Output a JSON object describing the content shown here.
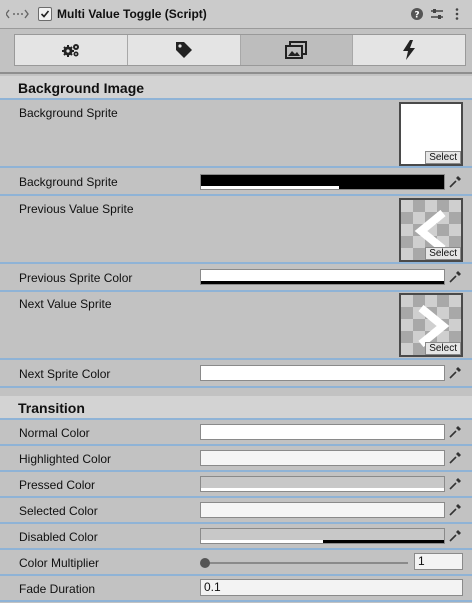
{
  "header": {
    "title": "Multi Value Toggle (Script)",
    "enabled": true
  },
  "tabs": [
    {
      "name": "settings",
      "icon": "gears-icon",
      "active": false
    },
    {
      "name": "labels",
      "icon": "tag-icon",
      "active": false
    },
    {
      "name": "images",
      "icon": "images-icon",
      "active": true
    },
    {
      "name": "events",
      "icon": "lightning-icon",
      "active": false
    }
  ],
  "background_image": {
    "section_label": "Background Image",
    "sprite_label": "Background Sprite",
    "color_label": "Background Sprite",
    "color": "#000000",
    "select_label": "Select"
  },
  "previous": {
    "sprite_label": "Previous Value Sprite",
    "color_label": "Previous Sprite Color",
    "color": "#ffffff",
    "select_label": "Select"
  },
  "next": {
    "sprite_label": "Next Value Sprite",
    "color_label": "Next Sprite Color",
    "color": "#ffffff",
    "select_label": "Select"
  },
  "transition": {
    "section_label": "Transition",
    "normal": {
      "label": "Normal Color",
      "color": "#ffffff"
    },
    "highlighted": {
      "label": "Highlighted Color",
      "color": "#f5f5f5"
    },
    "pressed": {
      "label": "Pressed Color",
      "color": "#c8c8c8"
    },
    "selected": {
      "label": "Selected Color",
      "color": "#f5f5f5"
    },
    "disabled": {
      "label": "Disabled Color",
      "color": "#c8c8c8"
    },
    "multiplier": {
      "label": "Color Multiplier",
      "value": "1",
      "slider_fraction": 0
    },
    "fade": {
      "label": "Fade Duration",
      "value": "0.1"
    }
  }
}
